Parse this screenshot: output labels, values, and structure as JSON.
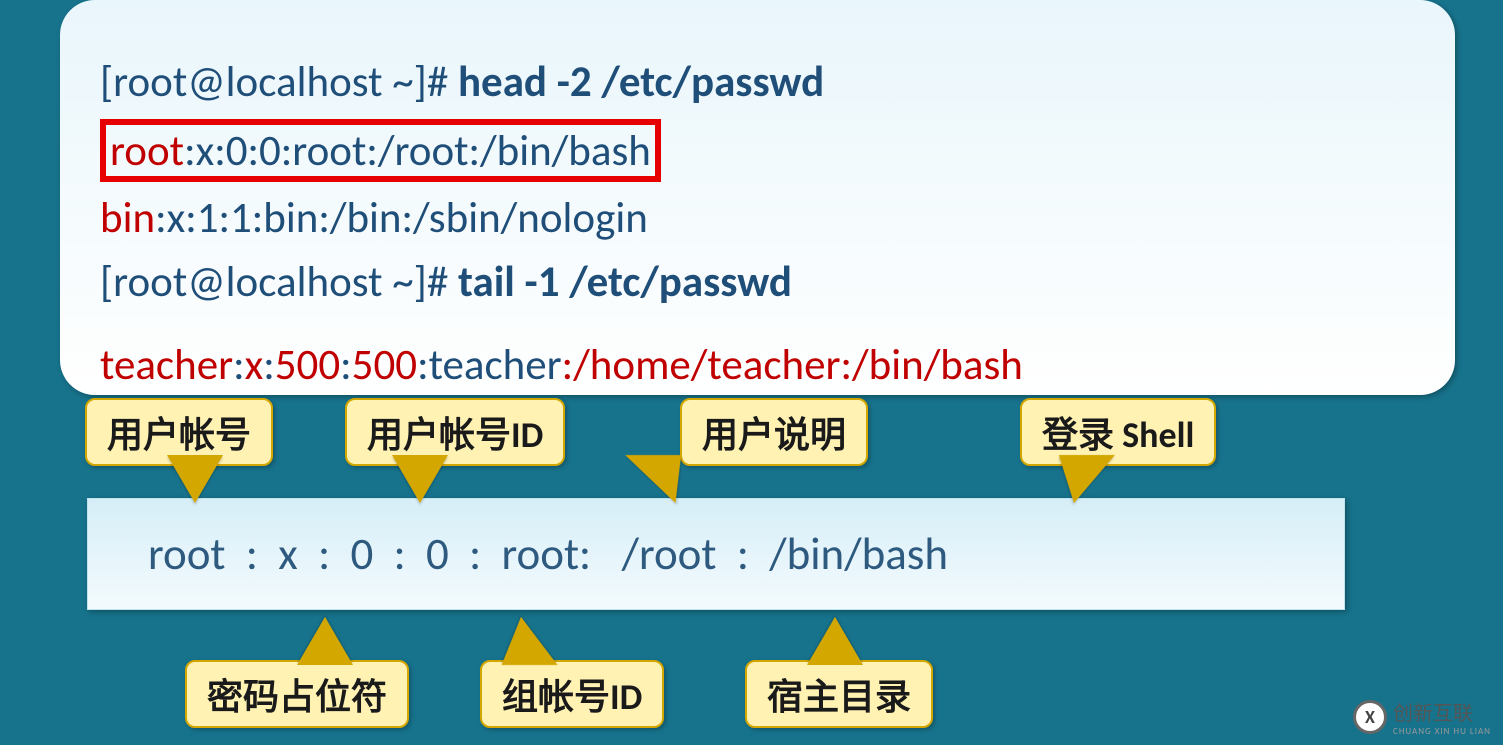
{
  "terminal": {
    "line1_prompt": "[root@localhost ~]# ",
    "line1_cmd": "head -2 /etc/passwd",
    "line2_user": "root",
    "line2_rest": ":x:0:0:root:/root:/bin/bash",
    "line3_user": "bin",
    "line3_rest": ":x:1:1:bin:/bin:/sbin/nologin",
    "line4_prompt": "[root@localhost ~]# ",
    "line4_cmd": "tail -1 /etc/passwd",
    "line5_p1": "teacher",
    "line5_p2": ":",
    "line5_p3": "x",
    "line5_p4": ":",
    "line5_p5": "500",
    "line5_p6": ":",
    "line5_p7": "500",
    "line5_p8": ":teacher",
    "line5_p9": ":",
    "line5_p10": "/home/teacher",
    "line5_p11": ":",
    "line5_p12": "/bin/bash"
  },
  "breakdown": "root  :  x  :  0  :  0  :  root:   /root  :  /bin/bash",
  "callouts": {
    "user_account": "用户帐号",
    "user_id": "用户帐号ID",
    "user_desc": "用户说明",
    "login_shell": "登录 Shell",
    "pw_placeholder": "密码占位符",
    "group_id": "组帐号ID",
    "home_dir": "宿主目录"
  },
  "watermark": {
    "brand": "创新互联",
    "sub": "CHUANG XIN HU LIAN",
    "logo": "X"
  }
}
